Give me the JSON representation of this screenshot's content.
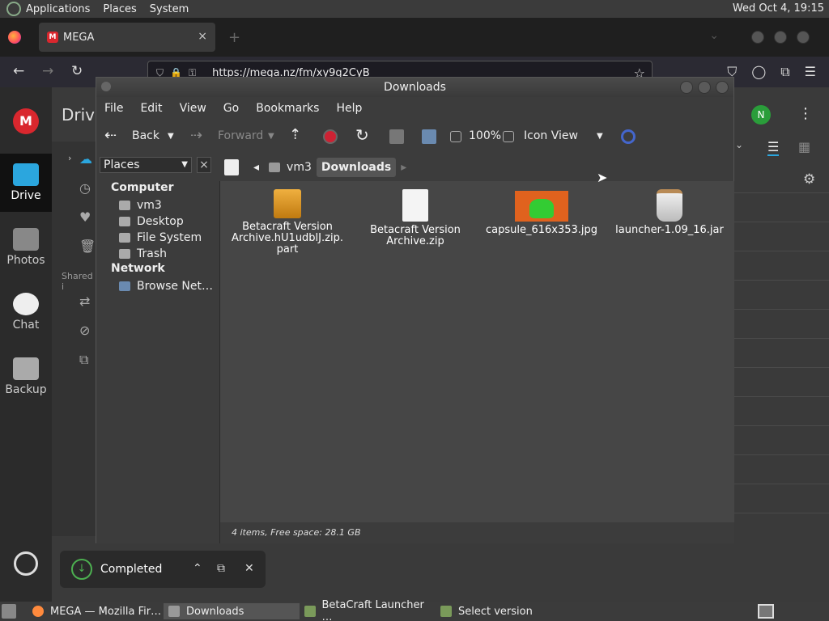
{
  "top_panel": {
    "menus": [
      "Applications",
      "Places",
      "System"
    ],
    "clock": "Wed Oct  4, 19:15"
  },
  "firefox": {
    "tab_title": "MEGA",
    "tab_close": "×",
    "new_tab": "+",
    "url": "https://mega.nz/fm/xy9g2CyB"
  },
  "mega": {
    "logo_letter": "M",
    "page_title": "Drive",
    "avatar_letter": "N",
    "nav": [
      {
        "label": "Drive"
      },
      {
        "label": "Photos"
      },
      {
        "label": "Chat"
      },
      {
        "label": "Backup"
      }
    ],
    "shared_label": "Shared i",
    "accent": "#d9272e"
  },
  "nautilus": {
    "title": "Downloads",
    "menu": [
      "File",
      "Edit",
      "View",
      "Go",
      "Bookmarks",
      "Help"
    ],
    "toolbar": {
      "back": "Back",
      "forward": "Forward",
      "zoom": "100%",
      "view_mode": "Icon View"
    },
    "sidebar": {
      "combo": "Places",
      "computer_header": "Computer",
      "computer_items": [
        "vm3",
        "Desktop",
        "File System",
        "Trash"
      ],
      "network_header": "Network",
      "network_items": [
        "Browse Net…"
      ]
    },
    "path": [
      "vm3",
      "Downloads"
    ],
    "files": [
      {
        "name_line1": "Betacraft Version",
        "name_line2": "Archive.hU1udblJ.zip.",
        "name_line3": "part",
        "type": "package"
      },
      {
        "name_line1": "Betacraft Version",
        "name_line2": "Archive.zip",
        "name_line3": "",
        "type": "document"
      },
      {
        "name_line1": "capsule_616x353.jpg",
        "name_line2": "",
        "name_line3": "",
        "type": "image"
      },
      {
        "name_line1": "launcher-1.09_16.jar",
        "name_line2": "",
        "name_line3": "",
        "type": "jar"
      }
    ],
    "status": "4 items, Free space: 28.1 GB"
  },
  "toast": {
    "label": "Completed"
  },
  "taskbar": [
    {
      "label": "MEGA — Mozilla Fir…",
      "active": false
    },
    {
      "label": "Downloads",
      "active": true
    },
    {
      "label": "BetaCraft Launcher …",
      "active": false
    },
    {
      "label": "Select version",
      "active": false
    }
  ]
}
